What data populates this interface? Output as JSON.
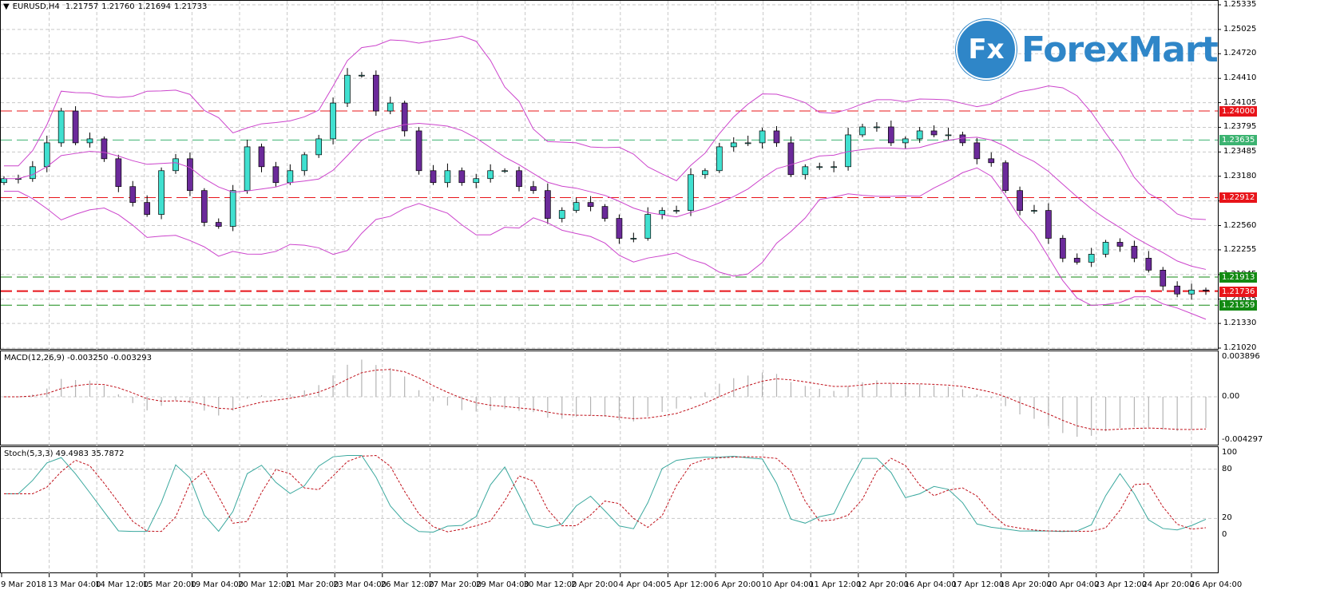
{
  "header": {
    "symbol_timeframe": "EURUSD,H4",
    "open": "1.21757",
    "high": "1.21760",
    "low": "1.21694",
    "close": "1.21733"
  },
  "logo": {
    "mark": "Fx",
    "text": "ForexMart"
  },
  "price_axis": {
    "labels": [
      "1.25335",
      "1.25025",
      "1.24720",
      "1.24410",
      "1.24105",
      "1.23795",
      "1.23485",
      "1.23180",
      "1.22870",
      "1.22560",
      "1.22255",
      "1.21945",
      "1.21635",
      "1.21330",
      "1.21020"
    ]
  },
  "levels": [
    {
      "price": 1.24,
      "label": "1.24000",
      "color": "#e8141a"
    },
    {
      "price": 1.23635,
      "label": "1.23635",
      "color": "#3cb371"
    },
    {
      "price": 1.22912,
      "label": "1.22912",
      "color": "#e8141a"
    },
    {
      "price": 1.21913,
      "label": "1.21913",
      "color": "#138a13"
    },
    {
      "price": 1.21736,
      "label": "1.21736",
      "color": "#e8141a"
    },
    {
      "price": 1.21559,
      "label": "1.21559",
      "color": "#138a13"
    }
  ],
  "macd": {
    "label": "MACD(12,26,9) -0.003250 -0.003293",
    "axis": [
      "0.003896",
      "0.00",
      "-0.004297"
    ]
  },
  "stoch": {
    "label": "Stoch(5,3,3) 49.4983 35.7872",
    "axis": [
      "100",
      "80",
      "20",
      "0"
    ]
  },
  "time_axis": [
    "9 Mar 2018",
    "13 Mar 04:00",
    "14 Mar 12:00",
    "15 Mar 20:00",
    "19 Mar 04:00",
    "20 Mar 12:00",
    "21 Mar 20:00",
    "23 Mar 04:00",
    "26 Mar 12:00",
    "27 Mar 20:00",
    "29 Mar 04:00",
    "30 Mar 12:00",
    "2 Apr 20:00",
    "4 Apr 04:00",
    "5 Apr 12:00",
    "6 Apr 20:00",
    "10 Apr 04:00",
    "11 Apr 12:00",
    "12 Apr 20:00",
    "16 Apr 04:00",
    "17 Apr 12:00",
    "18 Apr 20:00",
    "20 Apr 04:00",
    "23 Apr 12:00",
    "24 Apr 20:00",
    "26 Apr 04:00"
  ],
  "colors": {
    "bull": "#40e0d0",
    "bear": "#6b2a9a",
    "bands": "#cc44cc",
    "stoch_main": "#3aa89e",
    "signal": "#c0101a",
    "macd_hist": "#b4b4b4"
  },
  "chart_data": {
    "type": "candlestick",
    "title": "EURUSD,H4",
    "ylim": [
      1.2102,
      1.25335
    ],
    "closes": [
      1.2315,
      1.2315,
      1.233,
      1.236,
      1.24,
      1.236,
      1.2365,
      1.234,
      1.2305,
      1.2285,
      1.227,
      1.2325,
      1.234,
      1.23,
      1.226,
      1.2255,
      1.23,
      1.2355,
      1.233,
      1.231,
      1.2325,
      1.2345,
      1.2365,
      1.241,
      1.2445,
      1.2445,
      1.24,
      1.241,
      1.2375,
      1.2325,
      1.231,
      1.2325,
      1.231,
      1.2315,
      1.2325,
      1.2325,
      1.2305,
      1.23,
      1.2265,
      1.2275,
      1.2285,
      1.228,
      1.2265,
      1.224,
      1.224,
      1.227,
      1.2275,
      1.2275,
      1.232,
      1.2325,
      1.2355,
      1.236,
      1.236,
      1.2375,
      1.236,
      1.232,
      1.233,
      1.233,
      1.233,
      1.237,
      1.238,
      1.238,
      1.236,
      1.2365,
      1.2375,
      1.237,
      1.237,
      1.236,
      1.234,
      1.2335,
      1.23,
      1.2275,
      1.2275,
      1.224,
      1.2215,
      1.221,
      1.222,
      1.2235,
      1.223,
      1.2215,
      1.22,
      1.218,
      1.217,
      1.2175,
      1.2174
    ]
  }
}
